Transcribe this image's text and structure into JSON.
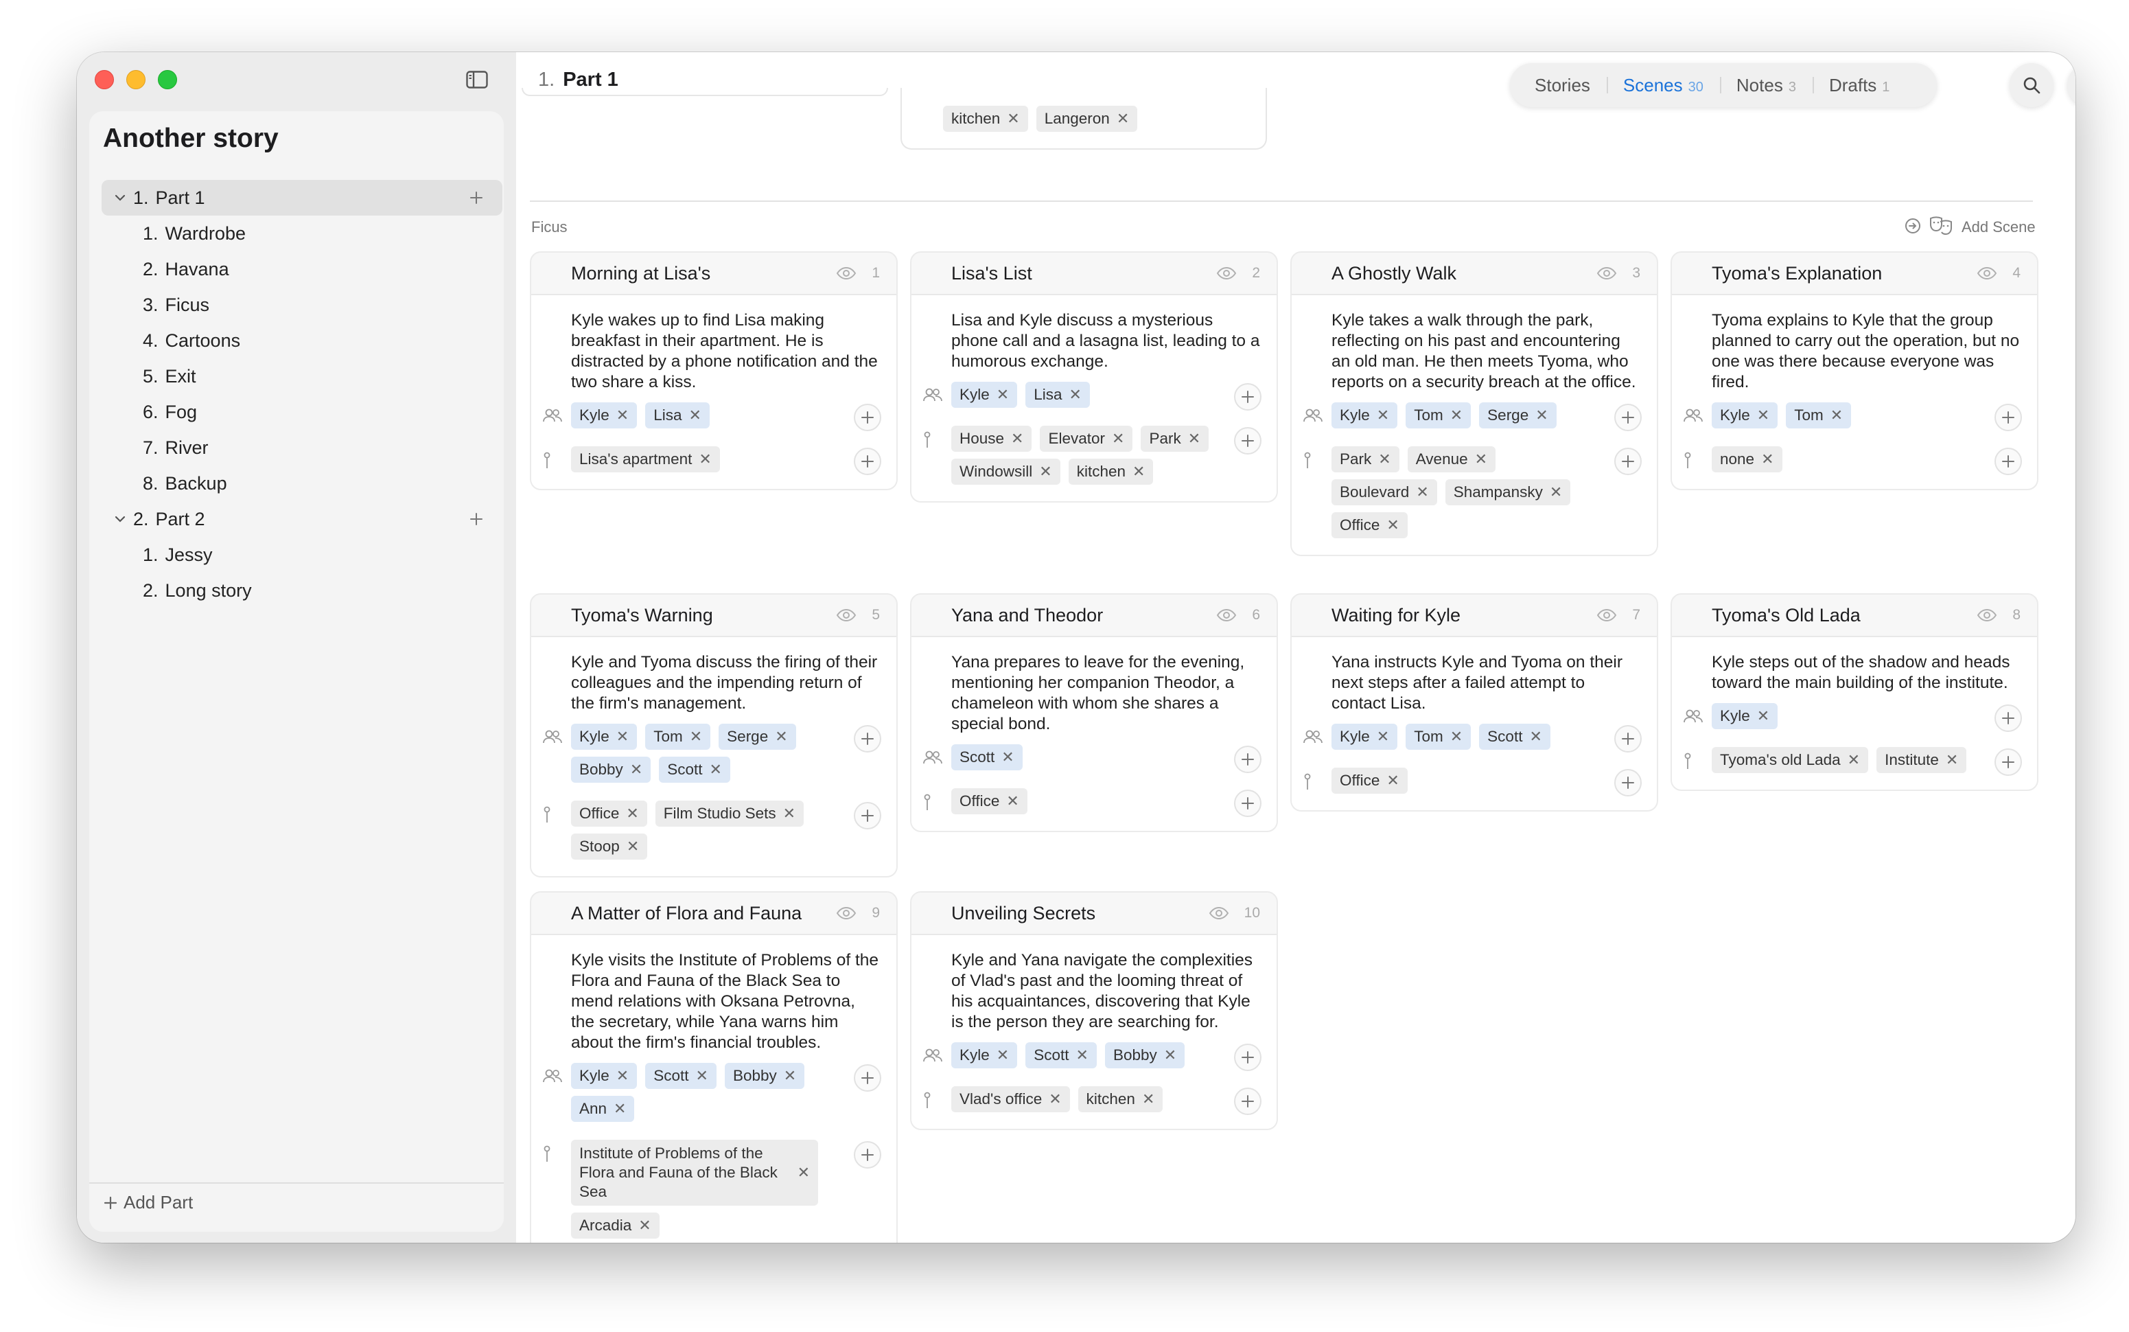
{
  "sidebar": {
    "story_title": "Another story",
    "add_part_label": "Add Part",
    "parts": [
      {
        "num": "1.",
        "title": "Part 1",
        "expanded": true,
        "selected": true,
        "chapters": [
          {
            "num": "1.",
            "title": "Wardrobe"
          },
          {
            "num": "2.",
            "title": "Havana"
          },
          {
            "num": "3.",
            "title": "Ficus"
          },
          {
            "num": "4.",
            "title": "Cartoons"
          },
          {
            "num": "5.",
            "title": "Exit"
          },
          {
            "num": "6.",
            "title": "Fog"
          },
          {
            "num": "7.",
            "title": "River"
          },
          {
            "num": "8.",
            "title": "Backup"
          }
        ]
      },
      {
        "num": "2.",
        "title": "Part 2",
        "expanded": true,
        "selected": false,
        "chapters": [
          {
            "num": "1.",
            "title": "Jessy"
          },
          {
            "num": "2.",
            "title": "Long story"
          }
        ]
      }
    ]
  },
  "header": {
    "part_num": "1.",
    "part_title": "Part 1",
    "tabs": [
      {
        "label": "Stories",
        "count": "",
        "active": false
      },
      {
        "label": "Scenes",
        "count": "30",
        "active": true
      },
      {
        "label": "Notes",
        "count": "3",
        "active": false
      },
      {
        "label": "Drafts",
        "count": "1",
        "active": false
      }
    ]
  },
  "prev_group": {
    "partial_tags": [
      "kitchen",
      "Langeron"
    ]
  },
  "group": {
    "label": "Ficus",
    "add_scene_label": "Add Scene"
  },
  "colors": {
    "accent": "#1a72d9",
    "character_tag": "#dde8f6",
    "place_tag": "#ececec"
  },
  "scenes": [
    {
      "title": "Morning at Lisa's",
      "index": "1",
      "description": "Kyle wakes up to find Lisa making breakfast in their apartment. He is distracted by a phone notification and the two share a kiss.",
      "characters": [
        "Kyle",
        "Lisa"
      ],
      "places": [
        "Lisa's apartment"
      ]
    },
    {
      "title": "Lisa's List",
      "index": "2",
      "description": "Lisa and Kyle discuss a mysterious phone call and a lasagna list, leading to a humorous exchange.",
      "characters": [
        "Kyle",
        "Lisa"
      ],
      "places": [
        "House",
        "Elevator",
        "Park",
        "Windowsill",
        "kitchen"
      ]
    },
    {
      "title": "A Ghostly Walk",
      "index": "3",
      "description": "Kyle takes a walk through the park, reflecting on his past and encountering an old man. He then meets Tyoma, who reports on a security breach at the office.",
      "characters": [
        "Kyle",
        "Tom",
        "Serge"
      ],
      "places": [
        "Park",
        "Avenue",
        "Boulevard",
        "Shampansky",
        "Office"
      ]
    },
    {
      "title": "Tyoma's Explanation",
      "index": "4",
      "description": "Tyoma explains to Kyle that the group planned to carry out the operation, but no one was there because everyone was fired.",
      "characters": [
        "Kyle",
        "Tom"
      ],
      "places": [
        "none"
      ]
    },
    {
      "title": "Tyoma's Warning",
      "index": "5",
      "description": "Kyle and Tyoma discuss the firing of their colleagues and the impending return of the firm's management.",
      "characters": [
        "Kyle",
        "Tom",
        "Serge",
        "Bobby",
        "Scott"
      ],
      "places": [
        "Office",
        "Film Studio Sets",
        "Stoop"
      ]
    },
    {
      "title": "Yana and Theodor",
      "index": "6",
      "description": "Yana prepares to leave for the evening, mentioning her companion Theodor, a chameleon with whom she shares a special bond.",
      "characters": [
        "Scott"
      ],
      "places": [
        "Office"
      ]
    },
    {
      "title": "Waiting for Kyle",
      "index": "7",
      "description": "Yana instructs Kyle and Tyoma on their next steps after a failed attempt to contact Lisa.",
      "characters": [
        "Kyle",
        "Tom",
        "Scott"
      ],
      "places": [
        "Office"
      ]
    },
    {
      "title": "Tyoma's Old Lada",
      "index": "8",
      "description": "Kyle steps out of the shadow and heads toward the main building of the institute.",
      "characters": [
        "Kyle"
      ],
      "places": [
        "Tyoma's old Lada",
        "Institute"
      ]
    },
    {
      "title": "A Matter of Flora and Fauna",
      "index": "9",
      "description": "Kyle visits the Institute of Problems of the Flora and Fauna of the Black Sea to mend relations with Oksana Petrovna, the secretary, while Yana warns him about the firm's financial troubles.",
      "characters": [
        "Kyle",
        "Scott",
        "Bobby",
        "Ann"
      ],
      "places": [
        "Institute of Problems of the Flora and Fauna of the Black Sea",
        "Arcadia"
      ]
    },
    {
      "title": "Unveiling Secrets",
      "index": "10",
      "description": "Kyle and Yana navigate the complexities of Vlad's past and the looming threat of his acquaintances, discovering that Kyle is the person they are searching for.",
      "characters": [
        "Kyle",
        "Scott",
        "Bobby"
      ],
      "places": [
        "Vlad's office",
        "kitchen"
      ]
    }
  ]
}
